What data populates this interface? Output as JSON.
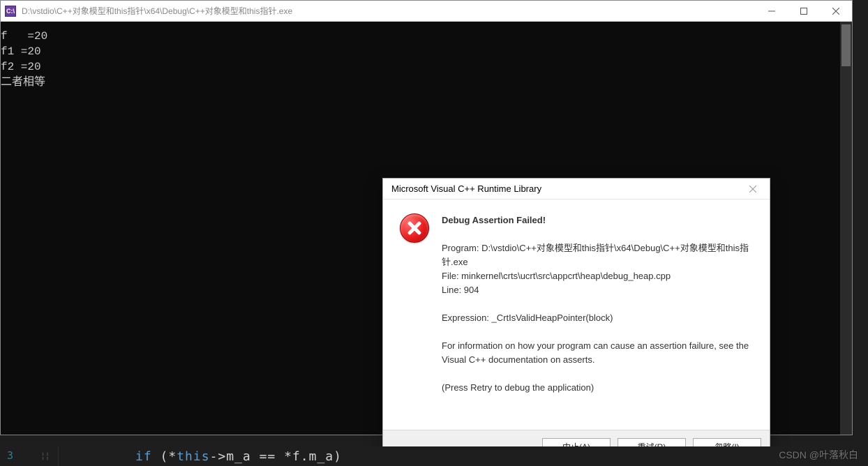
{
  "window": {
    "app_icon_label": "C:\\",
    "title": "D:\\vstdio\\C++对象模型和this指针\\x64\\Debug\\C++对象模型和this指针.exe"
  },
  "console": {
    "lines": [
      "f   =20",
      "f1 =20",
      "f2 =20",
      "二者相等"
    ]
  },
  "dialog": {
    "title": "Microsoft Visual C++ Runtime Library",
    "heading": "Debug Assertion Failed!",
    "program_label": "Program: D:\\vstdio\\C++对象模型和this指针\\x64\\Debug\\C++对象模型和this指针.exe",
    "file_label": "File: minkernel\\crts\\ucrt\\src\\appcrt\\heap\\debug_heap.cpp",
    "line_label": "Line: 904",
    "expression_label": "Expression: _CrtIsValidHeapPointer(block)",
    "info_text": "For information on how your program can cause an assertion failure, see the Visual C++ documentation on asserts.",
    "retry_hint": "(Press Retry to debug the application)",
    "buttons": {
      "abort": "中止(A)",
      "retry": "重试(R)",
      "ignore": "忽略(I)"
    }
  },
  "code_strip": {
    "line_number": "3",
    "code_prefix": "if ",
    "code_open": "(*",
    "code_kw": "this",
    "code_mid": "->m_a == *f.m_a)"
  },
  "watermark": "CSDN @叶落秋白"
}
